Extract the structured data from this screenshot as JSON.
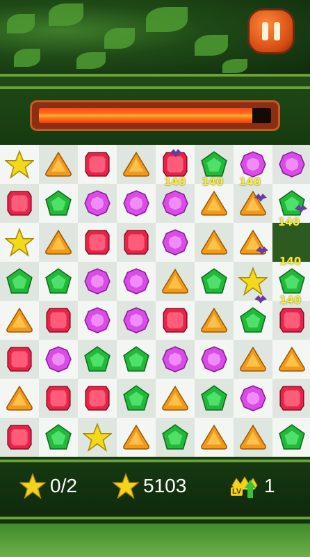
{
  "hud": {
    "stars_collected": "0/2",
    "score": "5103",
    "level_count": "1",
    "level_badge": "LV"
  },
  "progress": {
    "fill_fraction": 0.92
  },
  "board": {
    "rows": [
      [
        "star",
        "orange",
        "red",
        "orange",
        "red",
        "green",
        "purple",
        "purple"
      ],
      [
        "red",
        "green",
        "purple",
        "purple",
        "purple",
        "orange",
        "orange",
        "green"
      ],
      [
        "star",
        "orange",
        "red",
        "red",
        "purple",
        "orange",
        "orange",
        "empty"
      ],
      [
        "green",
        "green",
        "purple",
        "purple",
        "orange",
        "green",
        "star",
        "green"
      ],
      [
        "orange",
        "red",
        "purple",
        "purple",
        "red",
        "orange",
        "green",
        "red"
      ],
      [
        "red",
        "purple",
        "green",
        "green",
        "purple",
        "purple",
        "orange",
        "orange"
      ],
      [
        "orange",
        "red",
        "red",
        "green",
        "orange",
        "green",
        "purple",
        "red"
      ],
      [
        "red",
        "green",
        "star",
        "orange",
        "green",
        "orange",
        "orange",
        "green"
      ]
    ]
  },
  "popups": [
    "140",
    "140",
    "140",
    "140",
    "140",
    "140"
  ],
  "colors": {
    "red": "#e8234a",
    "orange": "#f19a1a",
    "green": "#22b83a",
    "purple": "#d94ce6",
    "star": "#f2da1a"
  },
  "icons": {
    "pause": "pause-icon",
    "star": "star-icon",
    "level": "crown-icon"
  }
}
